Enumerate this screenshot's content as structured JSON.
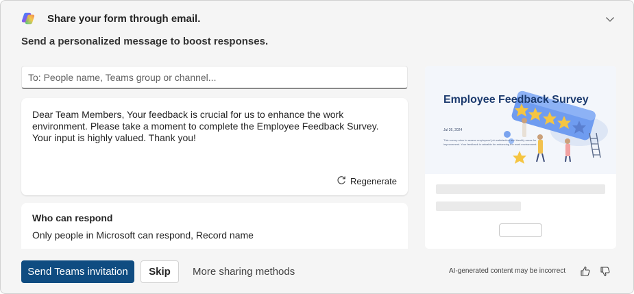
{
  "header": {
    "logo_icon": "copilot-logo-icon",
    "title": "Share your form through email.",
    "collapse_icon": "chevron-down-icon"
  },
  "subtitle": "Send a personalized message to boost responses.",
  "recipients": {
    "placeholder": "To: People name, Teams group or channel...",
    "value": ""
  },
  "message": {
    "text": "Dear Team Members, Your feedback is crucial for us to enhance the work environment. Please take a moment to complete the Employee Feedback Survey. Your input is highly valued. Thank you!",
    "regenerate_label": "Regenerate",
    "regenerate_icon": "refresh-icon"
  },
  "respond": {
    "title": "Who can respond",
    "description": "Only people in Microsoft can respond, Record name"
  },
  "preview": {
    "title": "Employee Feedback Survey",
    "date": "Jul 26, 2024",
    "body": "This survey aims to assess employees' job satisfaction and identify areas for improvement. Your feedback is valuable for enhancing the work environment.",
    "illustration_icon": "rating-stars-illustration"
  },
  "footer": {
    "primary_button": "Send Teams invitation",
    "skip_button": "Skip",
    "more_link": "More sharing methods",
    "ai_note": "AI-generated content may be incorrect",
    "like_icon": "thumbs-up-icon",
    "dislike_icon": "thumbs-down-icon"
  },
  "colors": {
    "primary": "#0f4c81",
    "banner_title": "#1b3a6e",
    "panel_bg": "#f5f5f5"
  }
}
